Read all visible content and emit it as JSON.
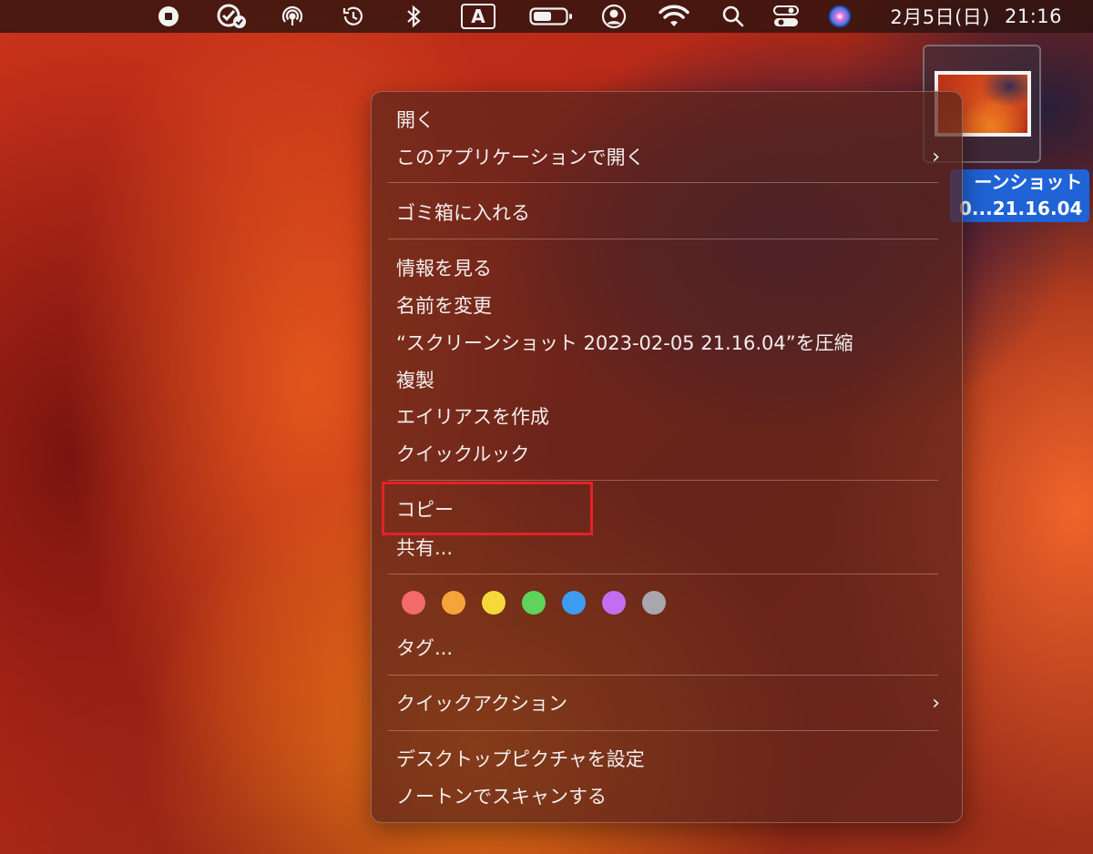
{
  "menubar": {
    "icons": [
      "stop-record-icon",
      "check-badge-icon",
      "airdrop-icon",
      "time-machine-icon",
      "bluetooth-icon",
      "input-source-icon",
      "battery-icon",
      "user-icon",
      "wifi-icon",
      "spotlight-search-icon",
      "control-center-icon",
      "siri-icon"
    ],
    "input_source_label": "A",
    "date": "2月5日(日)",
    "time": "21:16"
  },
  "desktop_file": {
    "name_line1": "ーンショット",
    "name_line2": "0...21.16.04"
  },
  "context_menu": {
    "items": [
      {
        "label": "開く"
      },
      {
        "label": "このアプリケーションで開く",
        "submenu": true
      },
      {
        "label": "ゴミ箱に入れる"
      },
      {
        "label": "情報を見る"
      },
      {
        "label": "名前を変更"
      },
      {
        "label": "“スクリーンショット 2023-02-05 21.16.04”を圧縮"
      },
      {
        "label": "複製"
      },
      {
        "label": "エイリアスを作成"
      },
      {
        "label": "クイックルック"
      },
      {
        "label": "コピー",
        "highlighted": true
      },
      {
        "label": "共有..."
      },
      {
        "label": "タグ..."
      },
      {
        "label": "クイックアクション",
        "submenu": true
      },
      {
        "label": "デスクトップピクチャを設定"
      },
      {
        "label": "ノートンでスキャンする"
      }
    ],
    "submenu_chevron": "›",
    "tag_colors": [
      {
        "name": "red",
        "color": "#f26a6a"
      },
      {
        "name": "orange",
        "color": "#f7a33c"
      },
      {
        "name": "yellow",
        "color": "#f5d93a"
      },
      {
        "name": "green",
        "color": "#5fd35a"
      },
      {
        "name": "blue",
        "color": "#3d9cf2"
      },
      {
        "name": "purple",
        "color": "#c26ef0"
      },
      {
        "name": "gray",
        "color": "#a7a7ad"
      }
    ]
  },
  "annotation": {
    "highlight_color": "#e3222a"
  }
}
